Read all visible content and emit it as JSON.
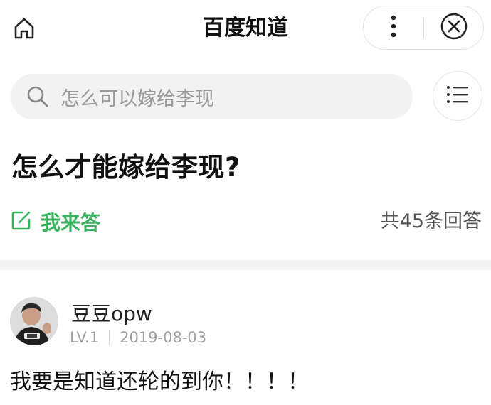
{
  "header": {
    "title": "百度知道",
    "home_icon": "home-icon",
    "more_icon": "more-vertical-icon",
    "close_icon": "close-icon"
  },
  "search": {
    "query": "怎么可以嫁给李现",
    "icon": "search-icon",
    "menu_icon": "list-menu-icon"
  },
  "question": {
    "title": "怎么才能嫁给李现?",
    "answer_button_label": "我来答",
    "answer_button_icon": "edit-icon",
    "answer_count_text": "共45条回答"
  },
  "answers": [
    {
      "username": "豆豆opw",
      "level": "LV.1",
      "date": "2019-08-03",
      "text": "我要是知道还轮的到你！！！！"
    }
  ],
  "colors": {
    "accent_green": "#38b35d",
    "muted_text": "#a0a0a0",
    "search_bg": "#f2f2f2"
  }
}
